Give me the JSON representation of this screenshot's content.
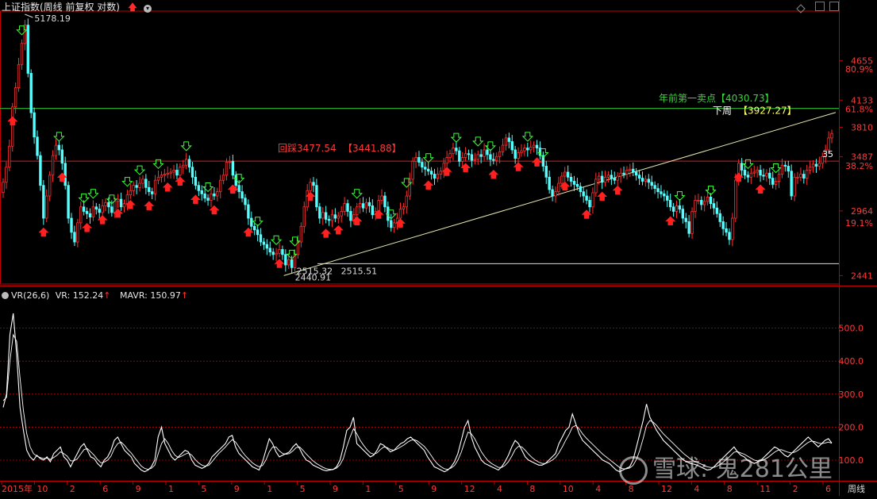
{
  "header": {
    "title": "上证指数(周线 前复权 对数)",
    "arrow": "🡅",
    "menu_glyph": "▾"
  },
  "watermark": {
    "text": "雪球: 鬼281公里"
  },
  "main_panel": {
    "peak_label": "5178.19",
    "low_label": "2440.91",
    "low_label2": "2515.32",
    "low_label3": "2515.51",
    "label_35": "35",
    "sell_line_label": "年前第一卖点【4030.73】",
    "pullback_label_prefix": "回踩3477.54",
    "pullback_label_value": "【3441.88】",
    "trend_label_prefix": "下周",
    "trend_label_value": "【3927.27】"
  },
  "indicator_panel": {
    "name": "VR(26,6)",
    "vr_label": "VR: 152.24",
    "mavr_label": "MAVR: 150.97",
    "arrow": "↑"
  },
  "colors": {
    "up": "#ff3030",
    "down": "#54ffff",
    "axis": "#c00000",
    "green_line": "#3ad53a",
    "red_line": "#d02020",
    "trend_line": "#e8e8b0",
    "gold": "#ffff66"
  },
  "chart_data": [
    {
      "type": "candlestick",
      "title": "上证指数(周线 前复权 对数)",
      "y_scale": "log",
      "ylim": [
        2380,
        5400
      ],
      "y_ticks": [
        4655,
        4133,
        3810,
        3487,
        2964,
        2441
      ],
      "fib_ticks": [
        {
          "label": "80.9%",
          "value": 4540
        },
        {
          "label": "61.8%",
          "value": 4025
        },
        {
          "label": "38.2%",
          "value": 3395
        },
        {
          "label": "19.1%",
          "value": 2860
        }
      ],
      "x_ticks": [
        "2015年",
        "10",
        "2",
        "6",
        "9",
        "1",
        "5",
        "9",
        "1",
        "5",
        "9",
        "1",
        "5",
        "9",
        "12",
        "4",
        "8",
        "10",
        "4",
        "8",
        "12",
        "4",
        "8",
        "11",
        "2",
        "6"
      ],
      "x_label_right": "周线",
      "annotations": {
        "peak": 5178.19,
        "low": 2440.91,
        "low2": 2515.32,
        "low3": 2515.51,
        "sell_point": 4030.73,
        "pullback": 3477.54,
        "pullback_value": 3441.88,
        "trend_next_week": 3927.27,
        "low_hline": 2530
      },
      "close": [
        3230,
        3380,
        3600,
        4050,
        4290,
        4600,
        4900,
        5178,
        4480,
        3980,
        3700,
        3500,
        3200,
        2900,
        3100,
        3300,
        3500,
        3610,
        3560,
        3420,
        3200,
        2900,
        2780,
        2700,
        2860,
        3000,
        2960,
        2940,
        2910,
        3000,
        2980,
        2950,
        3010,
        3040,
        3000,
        2950,
        3050,
        3070,
        3000,
        3030,
        3110,
        3150,
        3200,
        3180,
        3220,
        3260,
        3180,
        3140,
        3120,
        3250,
        3280,
        3300,
        3310,
        3320,
        3330,
        3350,
        3300,
        3380,
        3400,
        3460,
        3380,
        3280,
        3200,
        3150,
        3120,
        3080,
        3060,
        3120,
        3100,
        3140,
        3250,
        3300,
        3430,
        3440,
        3300,
        3200,
        3140,
        3080,
        3020,
        2900,
        2830,
        2800,
        2760,
        2700,
        2680,
        2650,
        2620,
        2600,
        2610,
        2640,
        2600,
        2520,
        2560,
        2500,
        2600,
        2700,
        2830,
        3000,
        3150,
        3230,
        3200,
        3000,
        2900,
        2950,
        2890,
        2880,
        2930,
        2900,
        2920,
        2960,
        3030,
        2960,
        2880,
        2930,
        3000,
        3030,
        2990,
        3040,
        3010,
        2930,
        2960,
        3060,
        3100,
        3000,
        2880,
        2820,
        2860,
        2900,
        2980,
        3000,
        3100,
        3260,
        3440,
        3480,
        3430,
        3380,
        3360,
        3340,
        3310,
        3270,
        3310,
        3340,
        3420,
        3480,
        3520,
        3580,
        3550,
        3440,
        3480,
        3520,
        3510,
        3450,
        3460,
        3510,
        3490,
        3560,
        3510,
        3460,
        3450,
        3490,
        3540,
        3610,
        3690,
        3650,
        3560,
        3470,
        3530,
        3550,
        3580,
        3560,
        3590,
        3610,
        3580,
        3500,
        3390,
        3280,
        3160,
        3100,
        3140,
        3220,
        3290,
        3330,
        3280,
        3240,
        3210,
        3190,
        3140,
        3100,
        3060,
        3000,
        3130,
        3260,
        3290,
        3230,
        3280,
        3300,
        3270,
        3250,
        3290,
        3320,
        3310,
        3350,
        3360,
        3330,
        3300,
        3270,
        3240,
        3260,
        3230,
        3200,
        3170,
        3140,
        3120,
        3100,
        3060,
        3000,
        2960,
        3010,
        2980,
        2900,
        2870,
        2770,
        2960,
        3060,
        3060,
        3020,
        3050,
        3090,
        3030,
        2990,
        2940,
        2870,
        2810,
        2780,
        2720,
        2900,
        3250,
        3420,
        3350,
        3300,
        3280,
        3320,
        3330,
        3350,
        3300,
        3290,
        3320,
        3270,
        3210,
        3240,
        3310,
        3400,
        3390,
        3340,
        3100,
        3280,
        3280,
        3310,
        3270,
        3350,
        3380,
        3410,
        3390,
        3420,
        3490,
        3560,
        3690,
        3740
      ],
      "buy_marks": [
        6,
        18,
        26,
        29,
        35,
        40,
        44,
        50,
        59,
        66,
        76,
        82,
        88,
        93,
        94,
        114,
        125,
        130,
        137,
        146,
        153,
        157,
        169,
        174,
        218,
        228,
        240,
        249
      ],
      "sell_marks": [
        3,
        13,
        19,
        27,
        32,
        37,
        41,
        47,
        53,
        57,
        62,
        68,
        74,
        79,
        89,
        99,
        104,
        108,
        114,
        121,
        128,
        137,
        143,
        149,
        158,
        166,
        172,
        181,
        188,
        193,
        198,
        215,
        237,
        244
      ],
      "vr_ylim": [
        40,
        600
      ],
      "vr_ticks": [
        500,
        400,
        300,
        200,
        100
      ],
      "vr_series": [
        {
          "name": "VR",
          "values": [
            260,
            300,
            480,
            545,
            420,
            260,
            190,
            130,
            110,
            100,
            115,
            105,
            100,
            110,
            95,
            120,
            130,
            140,
            110,
            100,
            80,
            100,
            120,
            140,
            150,
            130,
            110,
            105,
            90,
            80,
            100,
            110,
            130,
            160,
            170,
            150,
            130,
            120,
            110,
            90,
            80,
            70,
            65,
            70,
            80,
            100,
            170,
            200,
            150,
            130,
            110,
            100,
            110,
            120,
            130,
            125,
            100,
            85,
            80,
            75,
            80,
            90,
            110,
            120,
            130,
            140,
            150,
            170,
            175,
            140,
            120,
            110,
            100,
            90,
            80,
            75,
            70,
            95,
            130,
            165,
            150,
            125,
            110,
            115,
            120,
            125,
            140,
            150,
            135,
            115,
            100,
            95,
            85,
            80,
            75,
            70,
            68,
            70,
            72,
            80,
            100,
            140,
            190,
            200,
            230,
            150,
            140,
            130,
            120,
            110,
            115,
            130,
            150,
            145,
            135,
            125,
            130,
            140,
            150,
            155,
            165,
            170,
            160,
            150,
            140,
            130,
            110,
            95,
            80,
            75,
            70,
            65,
            70,
            80,
            95,
            120,
            160,
            200,
            220,
            170,
            140,
            120,
            100,
            90,
            85,
            80,
            75,
            70,
            80,
            95,
            115,
            140,
            160,
            150,
            130,
            110,
            100,
            95,
            90,
            85,
            85,
            90,
            100,
            110,
            120,
            150,
            170,
            190,
            200,
            240,
            210,
            180,
            160,
            150,
            140,
            130,
            120,
            110,
            100,
            95,
            90,
            80,
            70,
            65,
            70,
            75,
            80,
            100,
            140,
            180,
            220,
            270,
            230,
            210,
            190,
            175,
            160,
            150,
            140,
            130,
            120,
            110,
            100,
            95,
            90,
            88,
            85,
            80,
            75,
            70,
            72,
            80,
            90,
            100,
            110,
            120,
            130,
            140,
            125,
            115,
            110,
            100,
            95,
            90,
            95,
            100,
            110,
            120,
            130,
            140,
            135,
            125,
            115,
            110,
            120,
            130,
            140,
            150,
            160,
            170,
            160,
            150,
            140,
            150,
            160,
            165,
            152
          ]
        },
        {
          "name": "MAVR",
          "values": [
            280,
            290,
            400,
            480,
            460,
            350,
            250,
            180,
            140,
            120,
            112,
            108,
            105,
            106,
            102,
            108,
            115,
            125,
            120,
            112,
            98,
            98,
            104,
            118,
            132,
            135,
            125,
            115,
            102,
            92,
            94,
            100,
            112,
            135,
            150,
            155,
            145,
            132,
            122,
            108,
            95,
            82,
            75,
            72,
            75,
            85,
            118,
            150,
            165,
            150,
            130,
            115,
            108,
            112,
            118,
            122,
            115,
            102,
            92,
            85,
            82,
            84,
            95,
            108,
            120,
            130,
            140,
            152,
            162,
            155,
            140,
            125,
            112,
            102,
            92,
            85,
            80,
            84,
            100,
            125,
            140,
            140,
            128,
            120,
            118,
            120,
            128,
            138,
            140,
            130,
            118,
            108,
            98,
            90,
            84,
            78,
            74,
            72,
            72,
            76,
            86,
            105,
            140,
            170,
            195,
            180,
            160,
            145,
            132,
            122,
            118,
            122,
            132,
            140,
            138,
            132,
            130,
            134,
            140,
            146,
            154,
            160,
            162,
            158,
            150,
            142,
            130,
            115,
            100,
            88,
            80,
            74,
            72,
            76,
            84,
            100,
            124,
            155,
            185,
            180,
            165,
            145,
            125,
            110,
            98,
            90,
            84,
            78,
            78,
            84,
            95,
            112,
            132,
            142,
            140,
            130,
            118,
            108,
            100,
            94,
            90,
            90,
            94,
            100,
            108,
            122,
            140,
            160,
            178,
            200,
            205,
            195,
            180,
            168,
            158,
            148,
            138,
            128,
            118,
            110,
            102,
            94,
            86,
            78,
            74,
            74,
            76,
            84,
            102,
            130,
            165,
            205,
            220,
            215,
            205,
            192,
            180,
            170,
            160,
            150,
            140,
            130,
            120,
            112,
            104,
            98,
            93,
            89,
            85,
            80,
            78,
            78,
            82,
            88,
            96,
            104,
            114,
            124,
            126,
            122,
            118,
            112,
            106,
            100,
            98,
            98,
            102,
            108,
            116,
            124,
            130,
            132,
            128,
            124,
            122,
            124,
            130,
            138,
            146,
            154,
            158,
            156,
            152,
            150,
            152,
            155,
            151
          ]
        }
      ]
    }
  ]
}
